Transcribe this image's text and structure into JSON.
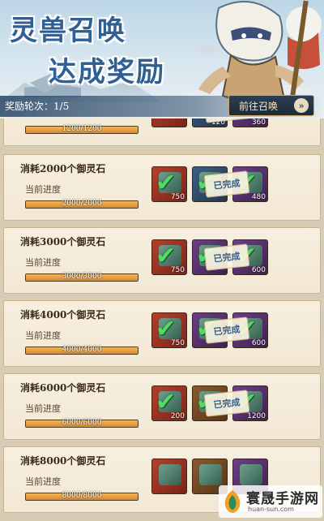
{
  "banner": {
    "title_line1": "灵兽召唤",
    "title_line2": "达成奖励",
    "reward_round": "奖励轮次：1/5",
    "goto_button": "前往召唤",
    "goto_arrow": "»"
  },
  "tasks": [
    {
      "title": "",
      "progress_label": "",
      "progress_text": "1200/1200",
      "progress_fraction": 1.0,
      "rewards": [
        {
          "color": "red",
          "count": "",
          "claimed": true
        },
        {
          "color": "blue",
          "count": "120",
          "claimed": true
        },
        {
          "color": "purple",
          "count": "360",
          "claimed": true
        }
      ],
      "status": "已完成"
    },
    {
      "title": "消耗2000个御灵石",
      "progress_label": "当前进度",
      "progress_text": "2000/2000",
      "progress_fraction": 1.0,
      "rewards": [
        {
          "color": "red",
          "count": "750",
          "claimed": true
        },
        {
          "color": "blue",
          "count": "",
          "claimed": true
        },
        {
          "color": "purple",
          "count": "480",
          "claimed": true
        }
      ],
      "status": "已完成"
    },
    {
      "title": "消耗3000个御灵石",
      "progress_label": "当前进度",
      "progress_text": "3000/3000",
      "progress_fraction": 1.0,
      "rewards": [
        {
          "color": "red",
          "count": "750",
          "claimed": true
        },
        {
          "color": "purple",
          "count": "",
          "claimed": true
        },
        {
          "color": "purple",
          "count": "600",
          "claimed": true
        }
      ],
      "status": "已完成"
    },
    {
      "title": "消耗4000个御灵石",
      "progress_label": "当前进度",
      "progress_text": "4000/4000",
      "progress_fraction": 1.0,
      "rewards": [
        {
          "color": "red",
          "count": "750",
          "claimed": true
        },
        {
          "color": "purple",
          "count": "",
          "claimed": true
        },
        {
          "color": "purple",
          "count": "600",
          "claimed": true
        }
      ],
      "status": "已完成"
    },
    {
      "title": "消耗6000个御灵石",
      "progress_label": "当前进度",
      "progress_text": "6000/6000",
      "progress_fraction": 1.0,
      "rewards": [
        {
          "color": "red",
          "count": "200",
          "claimed": true
        },
        {
          "color": "brown",
          "count": "",
          "claimed": true
        },
        {
          "color": "purple",
          "count": "1200",
          "claimed": true
        }
      ],
      "status": "已完成"
    },
    {
      "title": "消耗8000个御灵石",
      "progress_label": "当前进度",
      "progress_text": "8000/8000",
      "progress_fraction": 1.0,
      "rewards": [
        {
          "color": "red",
          "count": "",
          "claimed": false
        },
        {
          "color": "brown",
          "count": "",
          "claimed": false
        },
        {
          "color": "purple",
          "count": "",
          "claimed": false
        }
      ],
      "status": ""
    }
  ],
  "watermark": {
    "title": "寰晟手游网",
    "url": "huan-sun.com"
  },
  "colors": {
    "title_blue": "#2f5f93",
    "progress_orange": "#e8a040",
    "check_green": "#58d66a"
  },
  "icons": {
    "goto": "double-chevron-right-icon",
    "claimed": "check-icon"
  }
}
